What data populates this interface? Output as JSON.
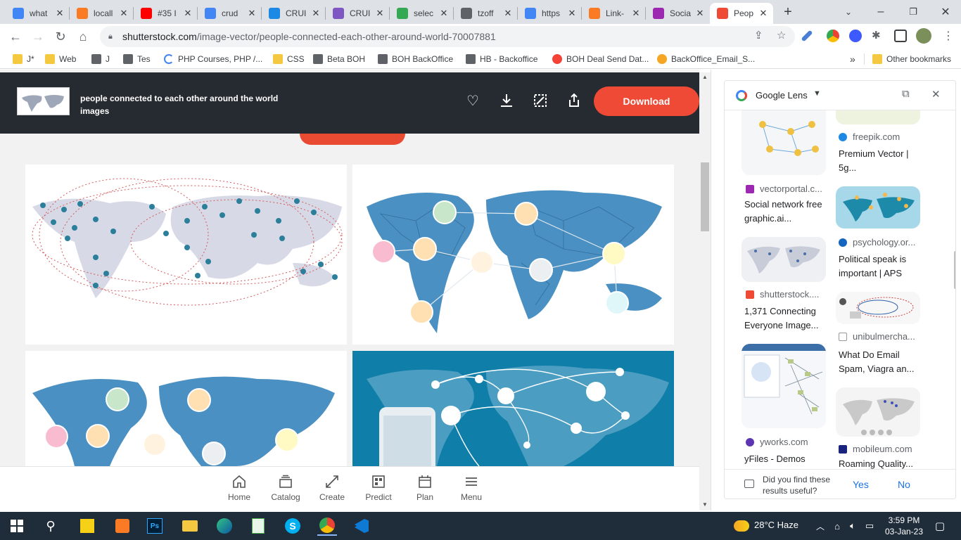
{
  "tabs": [
    {
      "label": "what",
      "icon": "google-icon",
      "color": "#4285f4"
    },
    {
      "label": "locall",
      "icon": "xampp-icon",
      "color": "#fb7a24"
    },
    {
      "label": "#35 I",
      "icon": "youtube-icon",
      "color": "#ff0000"
    },
    {
      "label": "crud",
      "icon": "google-icon",
      "color": "#4285f4"
    },
    {
      "label": "CRUI",
      "icon": "m-icon",
      "color": "#1e88e5"
    },
    {
      "label": "CRUI",
      "icon": "cube-icon",
      "color": "#7e57c2"
    },
    {
      "label": "selec",
      "icon": "star-icon",
      "color": "#34a853"
    },
    {
      "label": "tzoff",
      "icon": "globe-icon",
      "color": "#5f6368"
    },
    {
      "label": "https",
      "icon": "sites-icon",
      "color": "#4285f4"
    },
    {
      "label": "Link-",
      "icon": "xampp-icon",
      "color": "#fb7a24"
    },
    {
      "label": "Socia",
      "icon": "vp-icon",
      "color": "#9c27b0"
    },
    {
      "label": "Peop",
      "icon": "shutterstock-icon",
      "color": "#ee4a36"
    }
  ],
  "url": {
    "host": "shutterstock.com",
    "path": "/image-vector/people-connected-each-other-around-world-70007881"
  },
  "bookmarks": [
    {
      "label": "J*",
      "icon": "folder"
    },
    {
      "label": "Web",
      "icon": "folder"
    },
    {
      "label": "J",
      "icon": "globe"
    },
    {
      "label": "Tes",
      "icon": "globe"
    },
    {
      "label": "PHP Courses, PHP /...",
      "icon": "loader"
    },
    {
      "label": "CSS",
      "icon": "folder"
    },
    {
      "label": "Beta BOH",
      "icon": "globe"
    },
    {
      "label": "BOH BackOffice",
      "icon": "globe"
    },
    {
      "label": "HB - Backoffice",
      "icon": "globe"
    },
    {
      "label": "BOH Deal Send Dat...",
      "icon": "bulb"
    },
    {
      "label": "BackOffice_Email_S...",
      "icon": "paw"
    }
  ],
  "bookmarks_more": "»",
  "other_bookmarks": "Other bookmarks",
  "header": {
    "title": "people connected to each other around the world images",
    "download_label": "Download"
  },
  "bottom_nav": [
    {
      "label": "Home",
      "icon": "home-icon"
    },
    {
      "label": "Catalog",
      "icon": "catalog-icon"
    },
    {
      "label": "Create",
      "icon": "create-icon"
    },
    {
      "label": "Predict",
      "icon": "predict-icon"
    },
    {
      "label": "Plan",
      "icon": "plan-icon"
    },
    {
      "label": "Menu",
      "icon": "menu-icon"
    }
  ],
  "lens": {
    "title": "Google Lens",
    "left_col": [
      {
        "source": "vectorportal.c...",
        "title": "Social network free graphic.ai..."
      },
      {
        "source": "shutterstock....",
        "title": "1,371 Connecting Everyone Image..."
      },
      {
        "source": "yworks.com",
        "title": "yFiles - Demos"
      }
    ],
    "right_col": [
      {
        "source": "freepik.com",
        "title": "Premium Vector | 5g..."
      },
      {
        "source": "psychology.or...",
        "title": "Political speak is important | APS"
      },
      {
        "source": "unibulmercha...",
        "title": "What Do Email Spam, Viagra an..."
      },
      {
        "source": "mobileum.com",
        "title": "Roaming Quality..."
      }
    ],
    "feedback": {
      "question": "Did you find these results useful?",
      "yes": "Yes",
      "no": "No"
    }
  },
  "taskbar": {
    "weather": "28°C Haze",
    "time": "3:59 PM",
    "date": "03-Jan-23"
  },
  "colors": {
    "header_bg": "#262b31",
    "download_btn": "#ee4a36",
    "link_blue": "#1a73e8",
    "map_blue": "#4a90c2"
  }
}
